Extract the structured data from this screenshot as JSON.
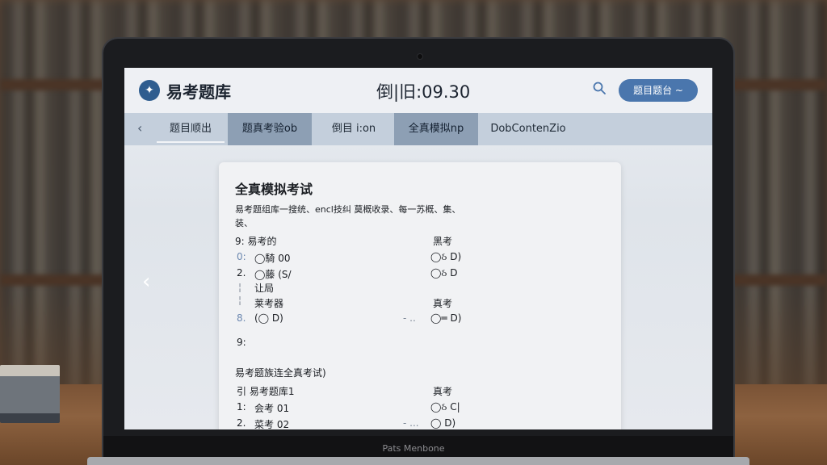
{
  "header": {
    "app_title": "易考题库",
    "timer": "倒|旧:09.30",
    "user_button": "题目题台 ~"
  },
  "nav": {
    "back_arrow": "‹",
    "tabs": [
      {
        "label": "题目顺出"
      },
      {
        "label": "题真考验ob"
      },
      {
        "label": "倒目 i:on"
      },
      {
        "label": "全真模拟np"
      },
      {
        "label": "DobContenZio"
      }
    ]
  },
  "card": {
    "title": "全真模拟考试",
    "intro": "易考题组库一搜统、encl技纠 莫概收录、每一苏概、集、装、",
    "section1": {
      "header_left": "9:  易考的",
      "header_right": "黑考",
      "rows": [
        {
          "num": "0:",
          "left": "◯騎 00",
          "right": "◯ઠ  D)"
        },
        {
          "num": "2.",
          "left": "◯藤 (S/",
          "right": "◯ઠ  D"
        },
        {
          "num": "¦",
          "left": "",
          "right": ""
        },
        {
          "num": "¦",
          "left": "让局",
          "right": ""
        }
      ],
      "sub_left": "莱考器",
      "sub_right": "真考",
      "row8_num": "8.",
      "row8_left": "(◯   D)",
      "row8_right": "◯═  D)",
      "row8_dots": "- ..",
      "q9": "9:"
    },
    "section2": {
      "title": "易考题族连全真考试)",
      "header_left": "引  易考题库1",
      "header_right": "真考",
      "rows": [
        {
          "num": "1:",
          "left": "会考  01",
          "right": "◯ઠ  C|"
        },
        {
          "num": "2.",
          "left": "菜考  02",
          "right": "◯    D)"
        }
      ],
      "row2_dots": "- ..."
    }
  },
  "laptop": {
    "brand": "Pats Menbone"
  },
  "side": {
    "left_arrow": "‹"
  }
}
